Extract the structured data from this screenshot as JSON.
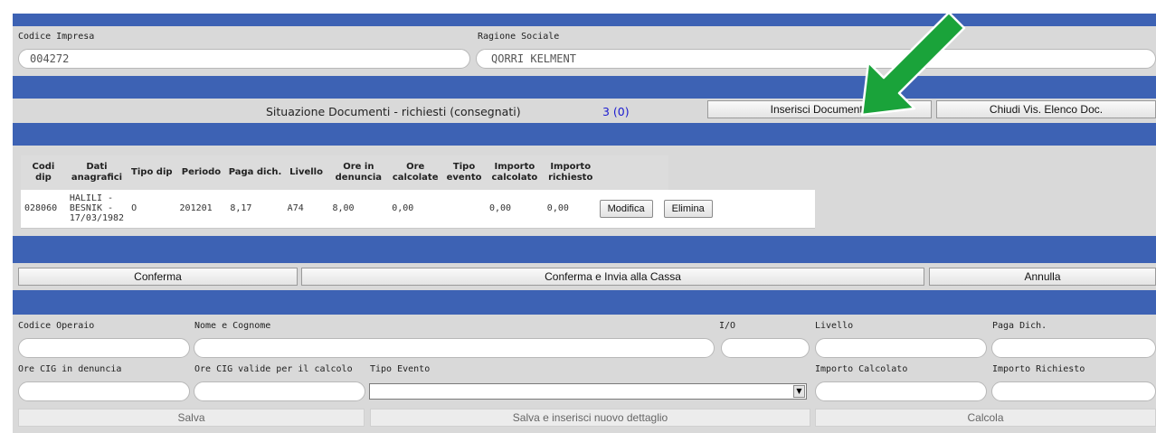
{
  "company": {
    "code_label": "Codice Impresa",
    "code_value": "004272",
    "name_label": "Ragione Sociale",
    "name_value": "QORRI KELMENT"
  },
  "documents": {
    "status_label": "Situazione Documenti - richiesti (consegnati)",
    "status_count": "3 (0)",
    "insert_button": "Inserisci Documento",
    "close_button": "Chiudi Vis. Elenco Doc."
  },
  "table": {
    "headers": [
      "Codi dip",
      "Dati anagrafici",
      "Tipo dip",
      "Periodo",
      "Paga dich.",
      "Livello",
      "Ore in denuncia",
      "Ore calcolate",
      "Tipo evento",
      "Importo calcolato",
      "Importo richiesto"
    ],
    "rows": [
      {
        "codi_dip": "028060",
        "dati": "HALILI - BESNIK - 17/03/1982",
        "tipo_dip": "O",
        "periodo": "201201",
        "paga": "8,17",
        "livello": "A74",
        "ore_denuncia": "8,00",
        "ore_calcolate": "0,00",
        "tipo_evento": "",
        "importo_calcolato": "0,00",
        "importo_richiesto": "0,00",
        "edit_label": "Modifica",
        "delete_label": "Elimina"
      }
    ]
  },
  "actions": {
    "confirm": "Conferma",
    "confirm_send": "Conferma e Invia alla Cassa",
    "cancel": "Annulla"
  },
  "detail": {
    "codice_operaio": "Codice Operaio",
    "nome_cognome": "Nome e Cognome",
    "io": "I/O",
    "livello": "Livello",
    "paga_dich": "Paga Dich.",
    "ore_cig_denuncia": "Ore CIG in denuncia",
    "ore_cig_valide": "Ore CIG valide per il calcolo",
    "tipo_evento": "Tipo Evento",
    "importo_calcolato": "Importo Calcolato",
    "importo_richiesto": "Importo Richiesto",
    "save": "Salva",
    "save_new": "Salva e inserisci nuovo dettaglio",
    "calculate": "Calcola"
  },
  "colors": {
    "header_blue": "#3d62b4",
    "panel_gray": "#d9d9d9",
    "arrow_green": "#1aa33a",
    "count_blue": "#1a1ad0"
  },
  "icons": {
    "annotation_arrow": "green-arrow-icon",
    "dropdown": "chevron-down-icon"
  }
}
